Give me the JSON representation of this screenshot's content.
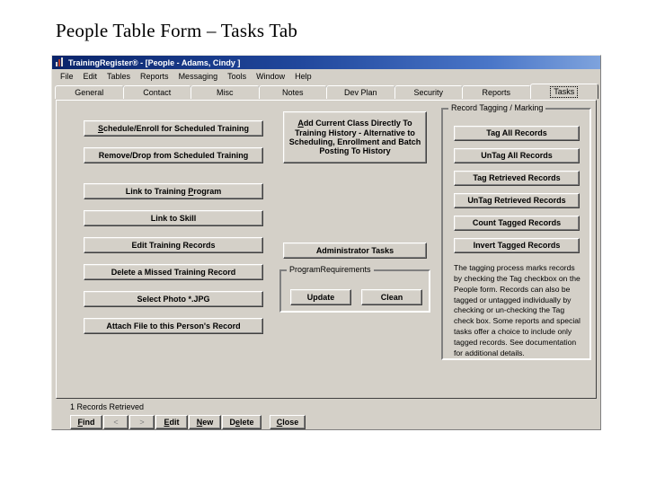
{
  "slide": {
    "title": "People Table Form – Tasks Tab"
  },
  "window": {
    "title": "TrainingRegister® - [People - Adams, Cindy ]",
    "icon": "chart-bars-icon",
    "menu": [
      "File",
      "Edit",
      "Tables",
      "Reports",
      "Messaging",
      "Tools",
      "Window",
      "Help"
    ],
    "tabs": [
      {
        "label": "General",
        "active": false
      },
      {
        "label": "Contact",
        "active": false
      },
      {
        "label": "Misc",
        "active": false
      },
      {
        "label": "Notes",
        "active": false
      },
      {
        "label": "Dev Plan",
        "active": false
      },
      {
        "label": "Security",
        "active": false
      },
      {
        "label": "Reports",
        "active": false
      },
      {
        "label": "Tasks",
        "active": true
      }
    ]
  },
  "tasks_tab": {
    "left_buttons": [
      {
        "label": "Schedule/Enroll for Scheduled Training",
        "accel": "S"
      },
      {
        "label": "Remove/Drop from Scheduled Training",
        "accel": ""
      },
      {
        "label": "Link to Training Program",
        "accel": "P"
      },
      {
        "label": "Link to Skill",
        "accel": ""
      },
      {
        "label": "Edit Training Records",
        "accel": ""
      },
      {
        "label": "Delete a Missed Training Record",
        "accel": ""
      },
      {
        "label": "Select Photo *.JPG",
        "accel": ""
      },
      {
        "label": "Attach File to this Person's Record",
        "accel": ""
      }
    ],
    "add_class_button": {
      "label": "Add Current Class Directly To Training History - Alternative to Scheduling, Enrollment and Batch Posting To History",
      "accel": "A"
    },
    "admin_button": {
      "label": "Administrator Tasks"
    },
    "program_requirements": {
      "legend": "ProgramRequirements",
      "update_label": "Update",
      "clean_label": "Clean"
    },
    "record_tagging": {
      "legend": "Record Tagging / Marking",
      "buttons": [
        "Tag All Records",
        "UnTag All Records",
        "Tag Retrieved Records",
        "UnTag Retrieved Records",
        "Count Tagged Records",
        "Invert Tagged Records"
      ],
      "description": "The tagging process marks records by checking the Tag checkbox on the People form.  Records can also be tagged or untagged individually by checking or un-checking the Tag check box. Some reports and special tasks offer a choice to include only tagged records.  See documentation for additional details."
    }
  },
  "bottom_bar": {
    "status": "1 Records Retrieved",
    "buttons": [
      {
        "label": "Find",
        "name": "find-button",
        "disabled": false
      },
      {
        "label": "<",
        "name": "previous-record-button",
        "disabled": true
      },
      {
        "label": ">",
        "name": "next-record-button",
        "disabled": true
      },
      {
        "label": "Edit",
        "name": "edit-button",
        "disabled": false
      },
      {
        "label": "New",
        "name": "new-button",
        "disabled": false
      },
      {
        "label": "Delete",
        "name": "delete-button",
        "disabled": false
      },
      {
        "label": "Close",
        "name": "close-button",
        "disabled": false
      }
    ]
  },
  "colors": {
    "face": "#d4d0c8",
    "titlebar_start": "#0a246a",
    "titlebar_end": "#7ea3dd",
    "text": "#000000"
  }
}
